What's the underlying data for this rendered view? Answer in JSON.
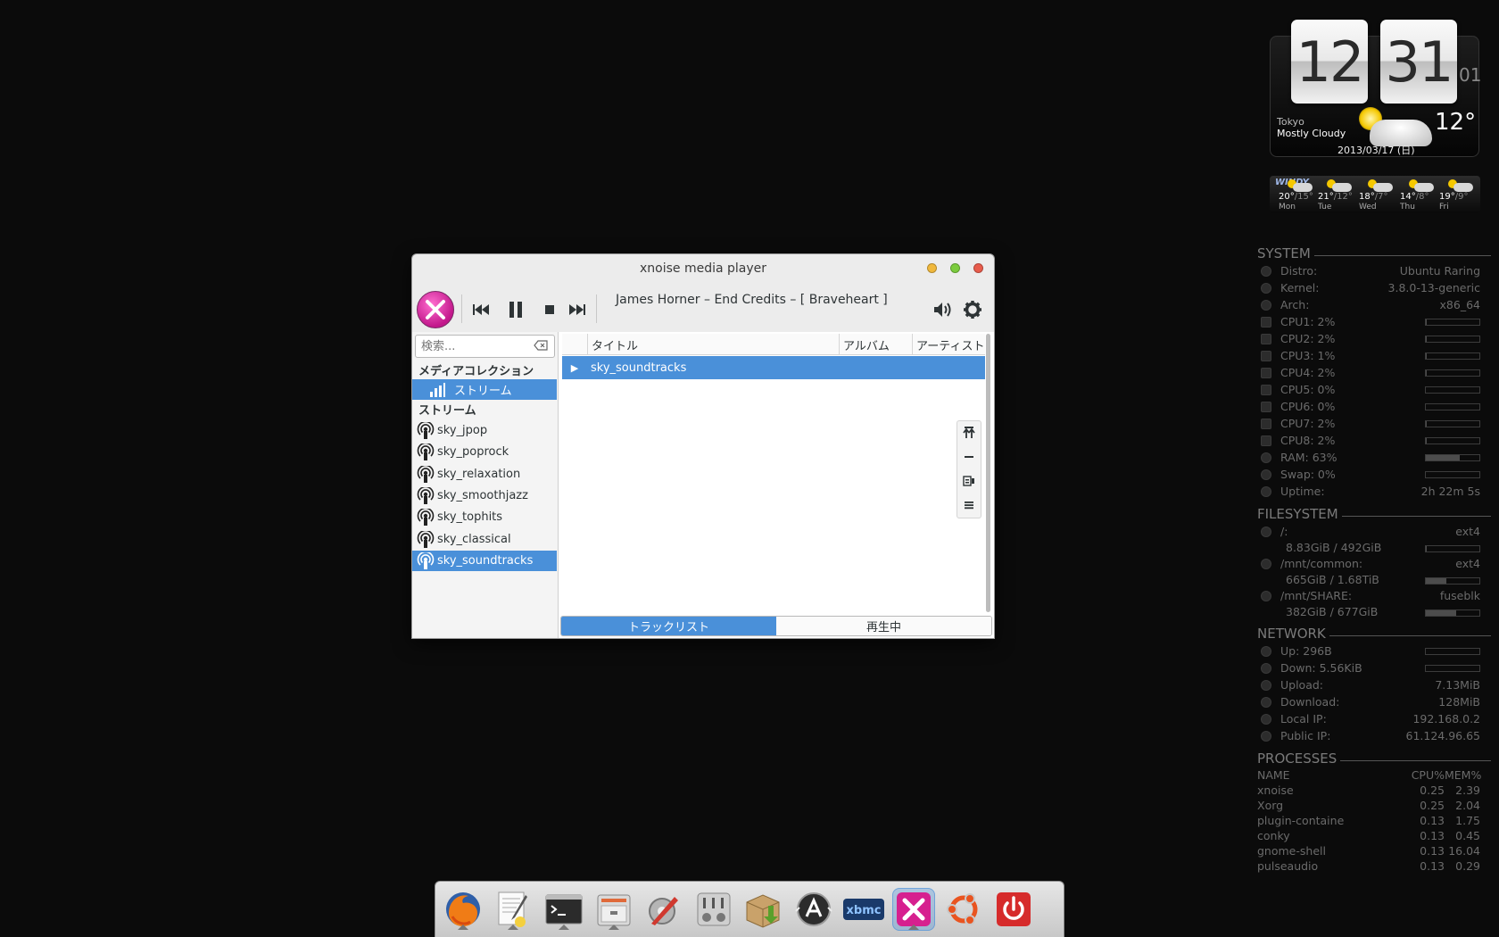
{
  "clock": {
    "hour": "12",
    "minute": "31",
    "seconds": "01",
    "city": "Tokyo",
    "condition": "Mostly Cloudy",
    "temperature": "12°",
    "date": "2013/03/17 (日)"
  },
  "forecast": {
    "badge": "WINDY",
    "days": [
      {
        "hi": "20°",
        "lo": "/15°",
        "name": "Mon"
      },
      {
        "hi": "21°",
        "lo": "/12°",
        "name": "Tue"
      },
      {
        "hi": "18°",
        "lo": "/7°",
        "name": "Wed"
      },
      {
        "hi": "14°",
        "lo": "/8°",
        "name": "Thu"
      },
      {
        "hi": "19°",
        "lo": "/9°",
        "name": "Fri"
      }
    ]
  },
  "conky": {
    "system": {
      "title": "SYSTEM",
      "distro_label": "Distro:",
      "distro": "Ubuntu Raring",
      "kernel_label": "Kernel:",
      "kernel": "3.8.0-13-generic",
      "arch_label": "Arch:",
      "arch": "x86_64",
      "cpus": [
        {
          "label": "CPU1: 2%",
          "level": 0.02
        },
        {
          "label": "CPU2: 2%",
          "level": 0.02
        },
        {
          "label": "CPU3: 1%",
          "level": 0.01
        },
        {
          "label": "CPU4: 2%",
          "level": 0.02
        },
        {
          "label": "CPU5: 0%",
          "level": 0.0
        },
        {
          "label": "CPU6: 0%",
          "level": 0.0
        },
        {
          "label": "CPU7: 2%",
          "level": 0.02
        },
        {
          "label": "CPU8: 2%",
          "level": 0.02
        }
      ],
      "ram_label": "RAM: 63%",
      "ram_level": 0.63,
      "swap_label": "Swap: 0%",
      "swap_level": 0.0,
      "uptime_label": "Uptime:",
      "uptime": "2h 22m 5s"
    },
    "filesystem": {
      "title": "FILESYSTEM",
      "mounts": [
        {
          "path": "/:",
          "type": "ext4",
          "usage": "8.83GiB / 492GiB",
          "level": 0.02
        },
        {
          "path": "/mnt/common:",
          "type": "ext4",
          "usage": "665GiB / 1.68TiB",
          "level": 0.39
        },
        {
          "path": "/mnt/SHARE:",
          "type": "fuseblk",
          "usage": "382GiB / 677GiB",
          "level": 0.56
        }
      ]
    },
    "network": {
      "title": "NETWORK",
      "up_label": "Up: 296B",
      "down_label": "Down: 5.56KiB",
      "upload_label": "Upload:",
      "upload": "7.13MiB",
      "download_label": "Download:",
      "download": "128MiB",
      "localip_label": "Local IP:",
      "localip": "192.168.0.2",
      "publicip_label": "Public IP:",
      "publicip": "61.124.96.65"
    },
    "processes": {
      "title": "PROCESSES",
      "header": {
        "name": "NAME",
        "cpu": "CPU%",
        "mem": "MEM%"
      },
      "rows": [
        {
          "name": "xnoise",
          "cpu": "0.25",
          "mem": "2.39"
        },
        {
          "name": "Xorg",
          "cpu": "0.25",
          "mem": "2.04"
        },
        {
          "name": "plugin-containe",
          "cpu": "0.13",
          "mem": "1.75"
        },
        {
          "name": "conky",
          "cpu": "0.13",
          "mem": "0.45"
        },
        {
          "name": "gnome-shell",
          "cpu": "0.13",
          "mem": "16.04"
        },
        {
          "name": "pulseaudio",
          "cpu": "0.13",
          "mem": "0.29"
        }
      ]
    }
  },
  "window": {
    "title": "xnoise media player",
    "now_playing": "James Horner – End Credits – [ Braveheart ]",
    "search_placeholder": "検索...",
    "media_collection": "メディアコレクション",
    "collection_stream": "ストリーム",
    "streams_header": "ストリーム",
    "streams": [
      "sky_jpop",
      "sky_poprock",
      "sky_relaxation",
      "sky_smoothjazz",
      "sky_tophits",
      "sky_classical",
      "sky_soundtracks"
    ],
    "selected_stream": 6,
    "columns": {
      "title": "タイトル",
      "album": "アルバム",
      "artist": "アーティスト"
    },
    "track": {
      "title": "sky_soundtracks",
      "marker": "▶"
    },
    "tabs": {
      "tracklist": "トラックリスト",
      "now_playing": "再生中"
    }
  },
  "dock": {
    "items": [
      "firefox-icon",
      "text-editor-icon",
      "terminal-icon",
      "file-manager-icon",
      "system-settings-icon",
      "mixer-icon",
      "package-installer-icon",
      "update-manager-icon",
      "xbmc-icon",
      "xnoise-icon",
      "ubuntu-icon",
      "power-icon"
    ],
    "xbmc_label": "xbmc"
  },
  "colors": {
    "selection": "#4a90d9",
    "xnoise_brand": "#c2178b",
    "desktop": "#0b0b0b"
  }
}
